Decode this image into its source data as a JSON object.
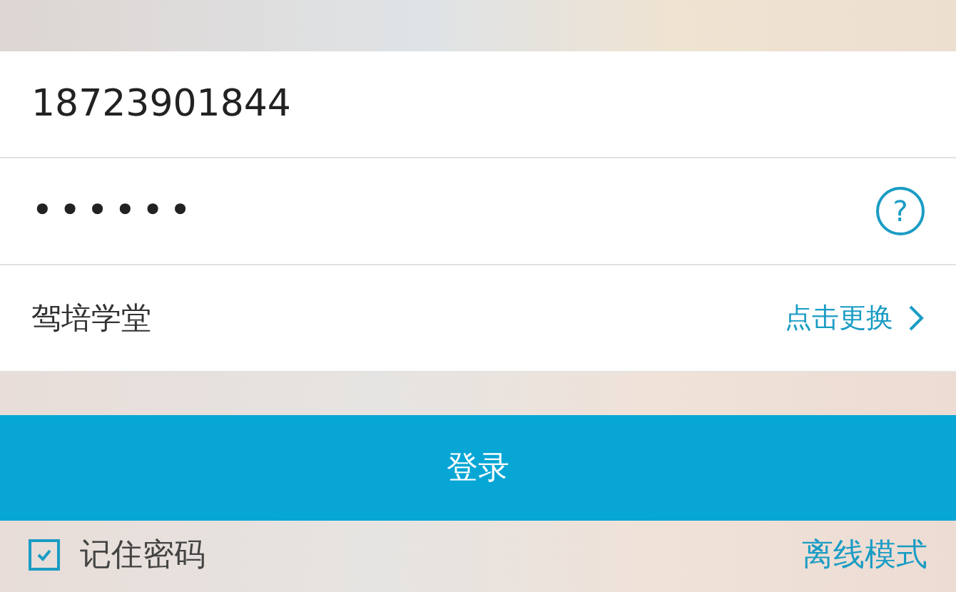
{
  "phone_field": {
    "value": "18723901844"
  },
  "password_field": {
    "value": "••••••",
    "help": "?"
  },
  "school": {
    "name": "驾培学堂",
    "action": "点击更换"
  },
  "login_button": {
    "label": "登录"
  },
  "remember": {
    "label": "记住密码",
    "checked": true
  },
  "offline_link": {
    "label": "离线模式"
  }
}
